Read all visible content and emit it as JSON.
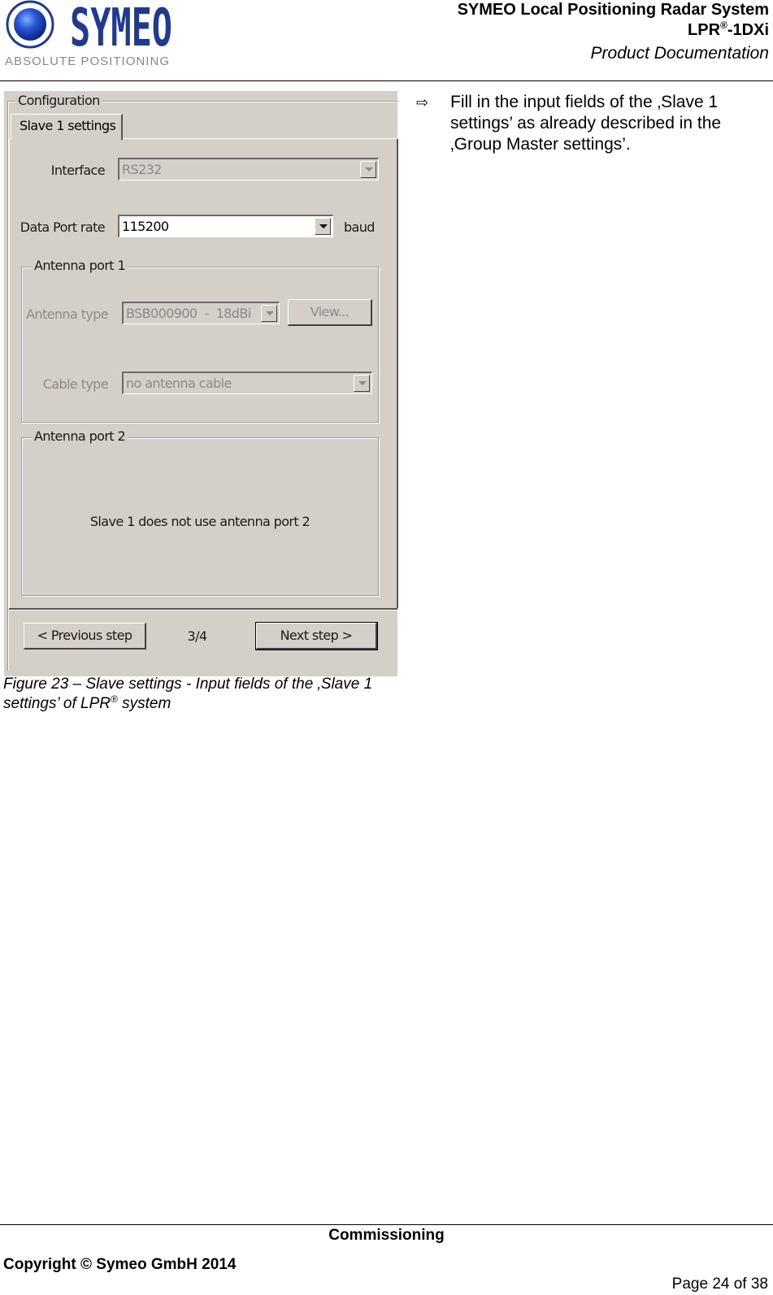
{
  "header": {
    "logo": {
      "brand": "SYMEO",
      "tagline": "ABSOLUTE POSITIONING",
      "colors": {
        "brand_blue": "#1f3a93",
        "tagline_gray": "#888888"
      }
    },
    "title_line1": "SYMEO Local Positioning Radar System",
    "title_line2_prefix": "LPR",
    "title_line2_sup": "®",
    "title_line2_suffix": "-1DXi",
    "title_line3": "Product Documentation"
  },
  "screenshot": {
    "group_title": "Configuration",
    "tab_label": "Slave 1 settings",
    "interface": {
      "label": "Interface",
      "value": "RS232",
      "enabled": false
    },
    "data_port_rate": {
      "label": "Data Port rate",
      "value": "115200",
      "unit": "baud",
      "enabled": true
    },
    "antenna_port_1": {
      "title": "Antenna port 1",
      "antenna_type": {
        "label": "Antenna type",
        "value": "BSB000900  -  18dBi",
        "enabled": false
      },
      "view_button": "View...",
      "cable_type": {
        "label": "Cable type",
        "value": "no antenna cable",
        "enabled": false
      }
    },
    "antenna_port_2": {
      "title": "Antenna port 2",
      "message": "Slave 1 does not use antenna port 2"
    },
    "nav": {
      "previous": "< Previous step",
      "step": "3/4",
      "next": "Next step >"
    },
    "colors": {
      "dialog_bg": "#d4d0c8",
      "disabled_text": "#8a8a8a"
    }
  },
  "caption": {
    "text_before": "Figure 23 – Slave settings - Input fields of the ‚Slave 1 settings’ of LPR",
    "sup": "®",
    "text_after": " system"
  },
  "instruction": {
    "icon": "right-arrow-outline-icon",
    "text": "Fill in the input fields of the ‚Slave 1 settings’ as already described in the ‚Group Master settings’."
  },
  "footer": {
    "section": "Commissioning",
    "copyright": "Copyright © Symeo GmbH 2014",
    "page": "Page 24 of 38"
  }
}
